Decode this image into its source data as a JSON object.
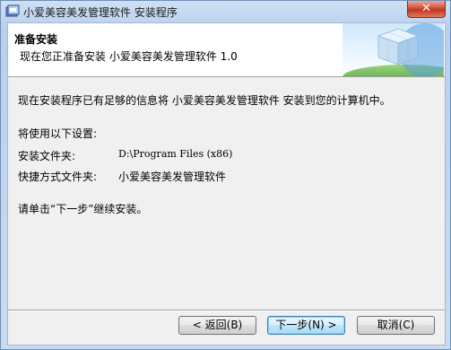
{
  "window": {
    "title": "小爱美容美发管理软件 安装程序",
    "close_glyph": "✕"
  },
  "header": {
    "title": "准备安装",
    "subtitle": "现在您正准备安装 小爱美容美发管理软件 1.0"
  },
  "content": {
    "intro": "现在安装程序已有足够的信息将 小爱美容美发管理软件 安装到您的计算机中。",
    "settings_heading": "将使用以下设置:",
    "install_folder_label": "安装文件夹:",
    "install_folder_value": "D:\\Program Files (x86)",
    "shortcut_folder_label": "快捷方式文件夹:",
    "shortcut_folder_value": "小爱美容美发管理软件",
    "instruction": "请单击“下一步”继续安装。"
  },
  "buttons": {
    "back": "< 返回(B)",
    "next": "下一步(N) >",
    "cancel": "取消(C)"
  }
}
